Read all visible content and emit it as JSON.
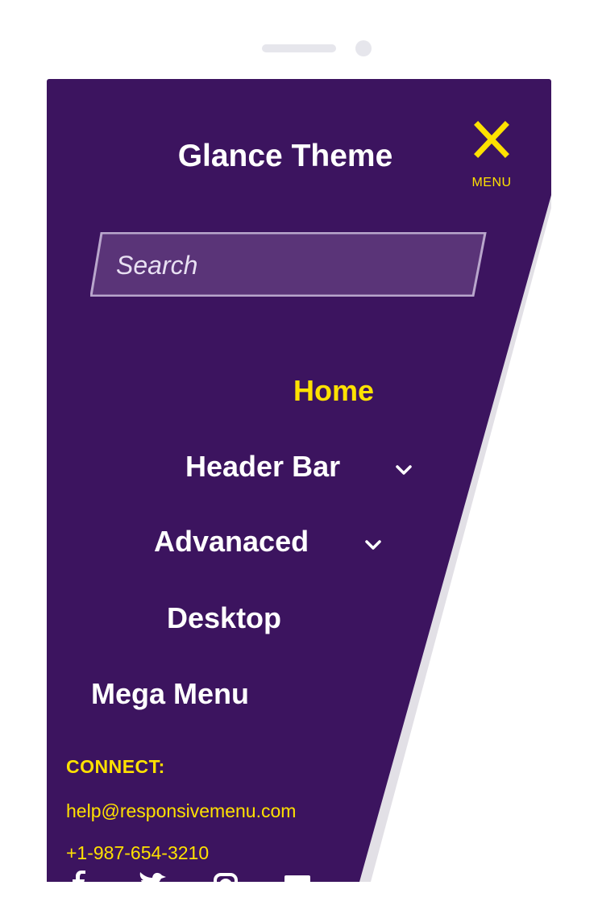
{
  "brand": {
    "title": "Glance Theme"
  },
  "toggle": {
    "label": "MENU",
    "icon": "close-icon"
  },
  "search": {
    "placeholder": "Search",
    "value": ""
  },
  "nav": {
    "items": [
      {
        "label": "Home",
        "active": true,
        "has_submenu": false
      },
      {
        "label": "Header Bar",
        "active": false,
        "has_submenu": true
      },
      {
        "label": "Advanaced",
        "active": false,
        "has_submenu": true
      },
      {
        "label": "Desktop",
        "active": false,
        "has_submenu": false
      },
      {
        "label": "Mega Menu",
        "active": false,
        "has_submenu": false
      }
    ]
  },
  "connect": {
    "heading": "CONNECT:",
    "email": "help@responsivemenu.com",
    "phone": "+1-987-654-3210"
  },
  "social": {
    "icons": [
      "facebook-icon",
      "twitter-icon",
      "instagram-icon",
      "mail-icon"
    ]
  },
  "colors": {
    "panel": "#3c145f",
    "accent": "#ffe100",
    "text": "#ffffff",
    "search_bg": "#5a3478",
    "search_border": "#b9a6cc"
  }
}
